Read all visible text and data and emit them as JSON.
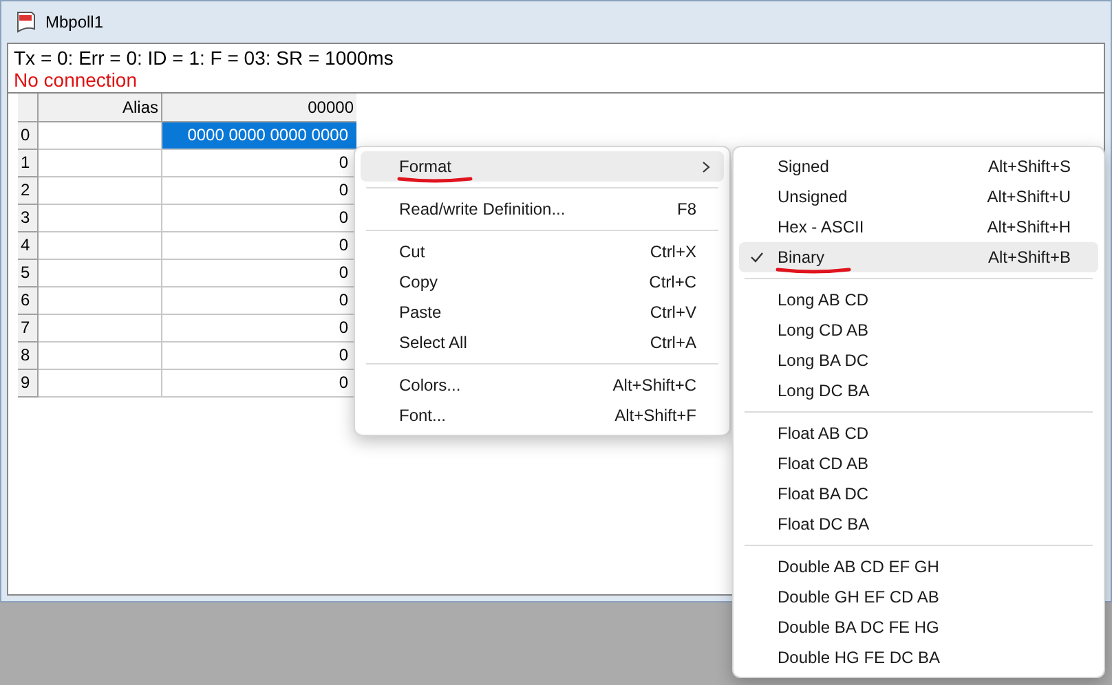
{
  "window": {
    "title": "Mbpoll1"
  },
  "status": {
    "line": "Tx = 0: Err = 0: ID = 1: F = 03: SR = 1000ms",
    "connection": "No connection"
  },
  "table": {
    "columns": [
      "Alias",
      "00000"
    ],
    "rows": [
      {
        "header": "0",
        "value": "0000 0000 0000 0000",
        "selected": true
      },
      {
        "header": "1",
        "value": "0",
        "selected": false
      },
      {
        "header": "2",
        "value": "0",
        "selected": false
      },
      {
        "header": "3",
        "value": "0",
        "selected": false
      },
      {
        "header": "4",
        "value": "0",
        "selected": false
      },
      {
        "header": "5",
        "value": "0",
        "selected": false
      },
      {
        "header": "6",
        "value": "0",
        "selected": false
      },
      {
        "header": "7",
        "value": "0",
        "selected": false
      },
      {
        "header": "8",
        "value": "0",
        "selected": false
      },
      {
        "header": "9",
        "value": "0",
        "selected": false
      }
    ]
  },
  "context_menu": {
    "groups": [
      [
        {
          "label": "Format",
          "submenu": true,
          "selected": true,
          "underlined": true
        }
      ],
      [
        {
          "label": "Read/write Definition...",
          "shortcut": "F8",
          "submenu": false,
          "selected": false,
          "underlined": false
        }
      ],
      [
        {
          "label": "Cut",
          "shortcut": "Ctrl+X",
          "submenu": false,
          "selected": false,
          "underlined": false
        },
        {
          "label": "Copy",
          "shortcut": "Ctrl+C",
          "submenu": false,
          "selected": false,
          "underlined": false
        },
        {
          "label": "Paste",
          "shortcut": "Ctrl+V",
          "submenu": false,
          "selected": false,
          "underlined": false
        },
        {
          "label": "Select All",
          "shortcut": "Ctrl+A",
          "submenu": false,
          "selected": false,
          "underlined": false
        }
      ],
      [
        {
          "label": "Colors...",
          "shortcut": "Alt+Shift+C",
          "submenu": false,
          "selected": false,
          "underlined": false
        },
        {
          "label": "Font...",
          "shortcut": "Alt+Shift+F",
          "submenu": false,
          "selected": false,
          "underlined": false
        }
      ]
    ]
  },
  "submenu": {
    "groups": [
      [
        {
          "label": "Signed",
          "shortcut": "Alt+Shift+S",
          "checked": false,
          "selected": false,
          "underlined": false
        },
        {
          "label": "Unsigned",
          "shortcut": "Alt+Shift+U",
          "checked": false,
          "selected": false,
          "underlined": false
        },
        {
          "label": "Hex - ASCII",
          "shortcut": "Alt+Shift+H",
          "checked": false,
          "selected": false,
          "underlined": false
        },
        {
          "label": "Binary",
          "shortcut": "Alt+Shift+B",
          "checked": true,
          "selected": true,
          "underlined": true
        }
      ],
      [
        {
          "label": "Long AB CD",
          "checked": false,
          "selected": false,
          "underlined": false
        },
        {
          "label": "Long CD AB",
          "checked": false,
          "selected": false,
          "underlined": false
        },
        {
          "label": "Long BA DC",
          "checked": false,
          "selected": false,
          "underlined": false
        },
        {
          "label": "Long DC BA",
          "checked": false,
          "selected": false,
          "underlined": false
        }
      ],
      [
        {
          "label": "Float AB CD",
          "checked": false,
          "selected": false,
          "underlined": false
        },
        {
          "label": "Float CD AB",
          "checked": false,
          "selected": false,
          "underlined": false
        },
        {
          "label": "Float BA DC",
          "checked": false,
          "selected": false,
          "underlined": false
        },
        {
          "label": "Float DC BA",
          "checked": false,
          "selected": false,
          "underlined": false
        }
      ],
      [
        {
          "label": "Double AB CD EF GH",
          "checked": false,
          "selected": false,
          "underlined": false
        },
        {
          "label": "Double GH EF CD AB",
          "checked": false,
          "selected": false,
          "underlined": false
        },
        {
          "label": "Double BA DC FE HG",
          "checked": false,
          "selected": false,
          "underlined": false
        },
        {
          "label": "Double HG FE DC BA",
          "checked": false,
          "selected": false,
          "underlined": false
        }
      ]
    ]
  }
}
